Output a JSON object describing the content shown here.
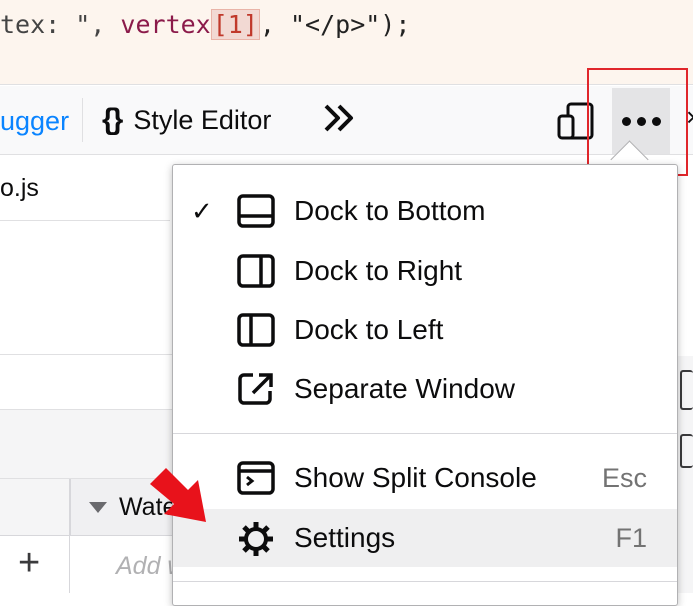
{
  "code": {
    "tokens": [
      {
        "t": "tex: \", ",
        "c": "str"
      },
      {
        "t": "vertex",
        "c": "ident"
      },
      {
        "t": "[1]",
        "c": "hl"
      },
      {
        "t": ", \"</p>\");",
        "c": "punc"
      }
    ]
  },
  "toolbar": {
    "debugger_tab": "ugger",
    "style_editor_tab": "Style Editor",
    "braces": "{}",
    "more_tools_icon": "chevron-double-right-icon",
    "responsive_icon": "responsive-design-icon",
    "meatball_icon": "meatball-menu-icon"
  },
  "debugger": {
    "file_tab": "o.js",
    "watch_label": "Wate",
    "add_watch_placeholder": "Add w",
    "add_button": "+"
  },
  "menu": {
    "items": [
      {
        "label": "Dock to Bottom",
        "checked": true,
        "icon": "dock-bottom-icon",
        "shortcut": ""
      },
      {
        "label": "Dock to Right",
        "checked": false,
        "icon": "dock-right-icon",
        "shortcut": ""
      },
      {
        "label": "Dock to Left",
        "checked": false,
        "icon": "dock-left-icon",
        "shortcut": ""
      },
      {
        "label": "Separate Window",
        "checked": false,
        "icon": "separate-window-icon",
        "shortcut": ""
      },
      {
        "label": "Show Split Console",
        "checked": false,
        "icon": "split-console-icon",
        "shortcut": "Esc"
      },
      {
        "label": "Settings",
        "checked": false,
        "icon": "settings-gear-icon",
        "shortcut": "F1"
      }
    ],
    "checkmark": "✓"
  },
  "colors": {
    "accent": "#0a84ff",
    "highlight_box": "#e0262b",
    "menu_hover": "#efeff0"
  }
}
